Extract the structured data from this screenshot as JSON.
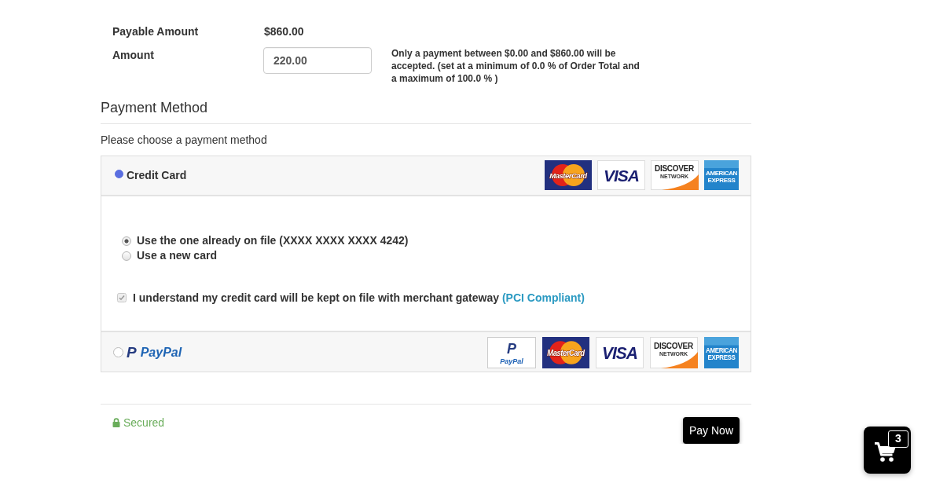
{
  "payable": {
    "label": "Payable Amount",
    "value": "$860.00"
  },
  "amount": {
    "label": "Amount",
    "value": "220.00",
    "note": "Only a payment between $0.00 and $860.00 will be accepted. (set at a minimum of 0.0 % of Order Total and a maximum of 100.0 % )"
  },
  "payment_method": {
    "heading": "Payment Method",
    "prompt": "Please choose a payment method",
    "methods": [
      {
        "kind": "credit_card",
        "label": "Credit Card",
        "selected": true,
        "logos": [
          {
            "kind": "mastercard",
            "lines": [
              "MasterCard"
            ]
          },
          {
            "kind": "visa",
            "lines": [
              "VISA"
            ]
          },
          {
            "kind": "discover",
            "lines": [
              "DISCOVER",
              "NETWORK"
            ]
          },
          {
            "kind": "amex",
            "lines": [
              "AMERICAN",
              "EXPRESS"
            ]
          }
        ],
        "options": [
          {
            "label": "Use the one already on file (XXXX XXXX XXXX 4242)",
            "selected": true
          },
          {
            "label": "Use a new card",
            "selected": false
          }
        ],
        "consent": {
          "text": "I understand my credit card will be kept on file with merchant gateway",
          "link": "(PCI Compliant)",
          "checked": true,
          "disabled": true
        }
      },
      {
        "kind": "paypal",
        "mark": "P",
        "label": "PayPal",
        "selected": false,
        "logos": [
          {
            "kind": "paypal",
            "lines": [
              "P",
              "PayPal"
            ]
          },
          {
            "kind": "mastercard",
            "lines": [
              "MasterCard"
            ]
          },
          {
            "kind": "visa",
            "lines": [
              "VISA"
            ]
          },
          {
            "kind": "discover",
            "lines": [
              "DISCOVER",
              "NETWORK"
            ]
          },
          {
            "kind": "amex",
            "lines": [
              "AMERICAN",
              "EXPRESS"
            ]
          }
        ]
      }
    ]
  },
  "footer": {
    "secured": "Secured",
    "pay_button": "Pay Now"
  },
  "cart": {
    "count": "3"
  }
}
